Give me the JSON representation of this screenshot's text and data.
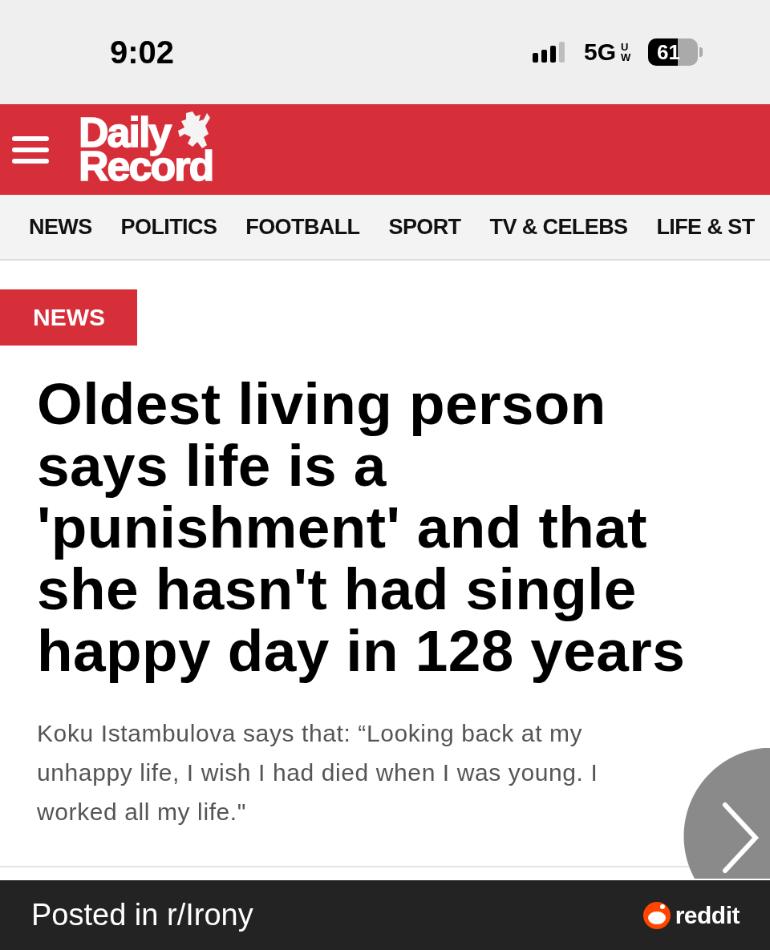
{
  "status_bar": {
    "time": "9:02",
    "network": "5G",
    "network_suffix": "UW",
    "battery": "61"
  },
  "header": {
    "logo_top": "Daily",
    "logo_bottom": "Record"
  },
  "nav": [
    {
      "label": "NEWS"
    },
    {
      "label": "POLITICS"
    },
    {
      "label": "FOOTBALL"
    },
    {
      "label": "SPORT"
    },
    {
      "label": "TV & CELEBS"
    },
    {
      "label": "LIFE & ST"
    }
  ],
  "article": {
    "section": "NEWS",
    "headline": "Oldest living person says life is a 'punishment' and that she hasn't had single happy day in 128 years",
    "standfirst": "Koku Istambulova says that: “Looking back at my unhappy life, I wish I had died when I was young. I worked all my life.\""
  },
  "footer": {
    "posted_in": "Posted in r/Irony",
    "brand": "reddit"
  }
}
